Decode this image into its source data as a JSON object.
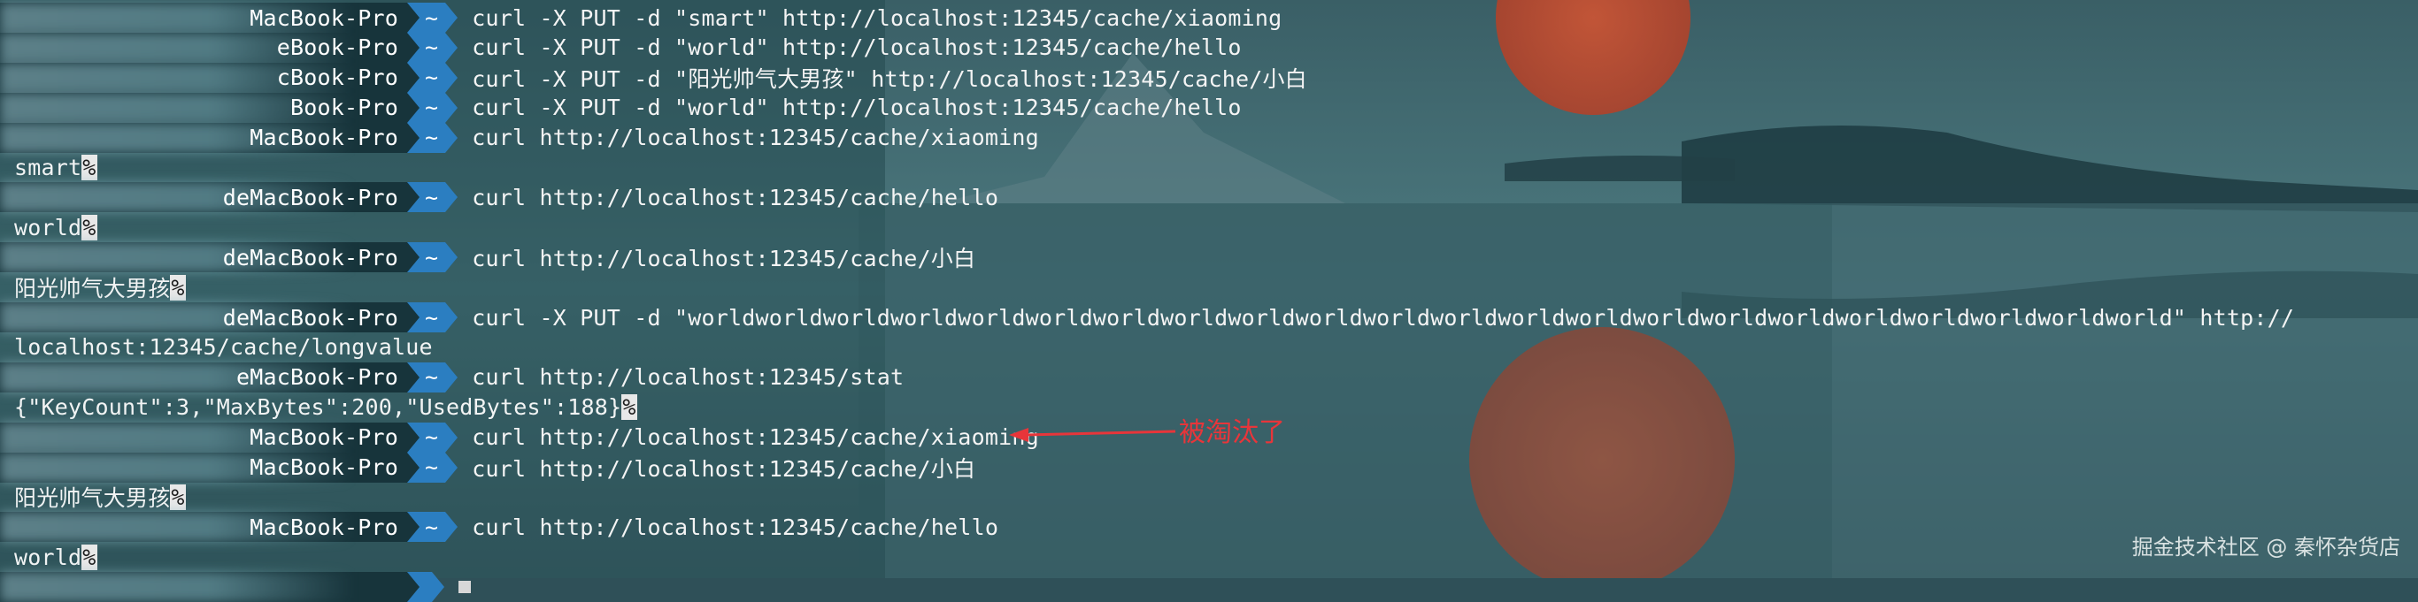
{
  "window": {
    "background_colors": {
      "sky": "#2f5058",
      "sun": "#d84a30",
      "prompt_host_bg": "#17343b",
      "prompt_dir_bg": "#2b7ec1",
      "annotation": "#e8353a"
    }
  },
  "lines": [
    {
      "type": "prompt",
      "host": "MacBook-Pro",
      "dir": "~",
      "cmd": "curl -X PUT -d \"smart\" http://localhost:12345/cache/xiaoming"
    },
    {
      "type": "prompt",
      "host": "eBook-Pro",
      "dir": "~",
      "cmd": "curl -X PUT -d \"world\" http://localhost:12345/cache/hello"
    },
    {
      "type": "prompt",
      "host": "cBook-Pro",
      "dir": "~",
      "cmd": "curl -X PUT -d \"阳光帅气大男孩\" http://localhost:12345/cache/小白"
    },
    {
      "type": "prompt",
      "host": "Book-Pro",
      "dir": "~",
      "cmd": "curl -X PUT -d \"world\" http://localhost:12345/cache/hello"
    },
    {
      "type": "prompt",
      "host": "MacBook-Pro",
      "dir": "~",
      "cmd": "curl http://localhost:12345/cache/xiaoming"
    },
    {
      "type": "output",
      "text": "smart",
      "pct": "%"
    },
    {
      "type": "prompt",
      "host": "deMacBook-Pro",
      "dir": "~",
      "cmd": "curl http://localhost:12345/cache/hello"
    },
    {
      "type": "output",
      "text": "world",
      "pct": "%"
    },
    {
      "type": "prompt",
      "host": "deMacBook-Pro",
      "dir": "~",
      "cmd": "curl http://localhost:12345/cache/小白"
    },
    {
      "type": "output",
      "text": "阳光帅气大男孩",
      "pct": "%"
    },
    {
      "type": "prompt",
      "host": "deMacBook-Pro",
      "dir": "~",
      "cmd": "curl -X PUT -d \"worldworldworldworldworldworldworldworldworldworldworldworldworldworldworldworldworldworldworldworldworldworld\" http://"
    },
    {
      "type": "output",
      "text": "localhost:12345/cache/longvalue",
      "pct": ""
    },
    {
      "type": "prompt",
      "host": "eMacBook-Pro",
      "dir": "~",
      "cmd": "curl http://localhost:12345/stat"
    },
    {
      "type": "output",
      "text": "{\"KeyCount\":3,\"MaxBytes\":200,\"UsedBytes\":188}",
      "pct": "%"
    },
    {
      "type": "prompt",
      "host": "MacBook-Pro",
      "dir": "~",
      "cmd": "curl http://localhost:12345/cache/xiaoming"
    },
    {
      "type": "prompt",
      "host": "MacBook-Pro",
      "dir": "~",
      "cmd": "curl http://localhost:12345/cache/小白"
    },
    {
      "type": "output",
      "text": "阳光帅气大男孩",
      "pct": "%"
    },
    {
      "type": "prompt",
      "host": "MacBook-Pro",
      "dir": "~",
      "cmd": "curl http://localhost:12345/cache/hello"
    },
    {
      "type": "output",
      "text": "world",
      "pct": "%"
    },
    {
      "type": "partial-prompt",
      "host": "",
      "dir": "",
      "cmd": ""
    }
  ],
  "annotation": {
    "text": "被淘汰了",
    "target_line": 14
  },
  "watermark": "掘金技术社区 @ 秦怀杂货店"
}
